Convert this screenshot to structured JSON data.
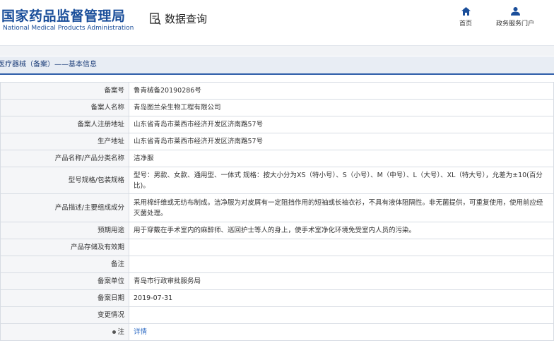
{
  "header": {
    "logo_cn": "国家药品监督管理局",
    "logo_en": "National Medical Products Administration",
    "query_title": "数据查询",
    "nav": {
      "home": "首页",
      "portal": "政务服务门户"
    }
  },
  "breadcrumb": "医疗器械（备案）——基本信息",
  "colors": {
    "brand_blue": "#1a4e9a",
    "crumb_bg": "#e8edf4",
    "link": "#2e6bc4"
  },
  "rows": [
    {
      "label": "备案号",
      "value": "鲁青械备20190286号"
    },
    {
      "label": "备案人名称",
      "value": "青岛图兰朵生物工程有限公司"
    },
    {
      "label": "备案人注册地址",
      "value": "山东省青岛市莱西市经济开发区济南路57号"
    },
    {
      "label": "生产地址",
      "value": "山东省青岛市莱西市经济开发区济南路57号"
    },
    {
      "label": "产品名称/产品分类名称",
      "value": "洁净服"
    },
    {
      "label": "型号规格/包装规格",
      "value": "型号：男款、女款、通用型、一体式 规格：按大小分为XS（特小号）、S（小号）、M（中号）、L（大号）、XL（特大号），允差为±10(百分比)。"
    },
    {
      "label": "产品描述/主要组成成分",
      "value": "采用棉纤维或无纺布制成。洁净服为对皮屑有一定阻挡作用的短袖或长袖衣衫，不具有液体阻隔性。非无菌提供，可重复使用，使用前应经灭菌处理。"
    },
    {
      "label": "预期用途",
      "value": "用于穿戴在手术室内的麻醉师、巡回护士等人的身上，使手术室净化环境免受室内人员的污染。"
    },
    {
      "label": "产品存储及有效期",
      "value": ""
    },
    {
      "label": "备注",
      "value": ""
    },
    {
      "label": "备案单位",
      "value": "青岛市行政审批服务局"
    },
    {
      "label": "备案日期",
      "value": "2019-07-31"
    },
    {
      "label": "变更情况",
      "value": ""
    },
    {
      "label": "注",
      "value": "详情"
    }
  ]
}
